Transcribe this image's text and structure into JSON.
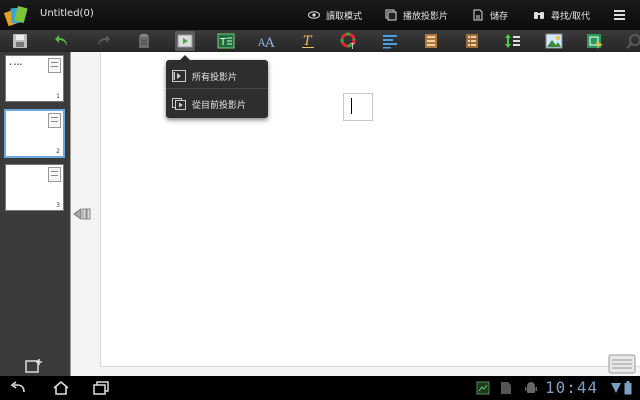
{
  "app": {
    "doc_title": "Untitled(0)"
  },
  "actionbar": {
    "read_mode_label": "讀取模式",
    "play_slides_label": "播放投影片",
    "save_label": "儲存",
    "find_replace_label": "尋找/取代"
  },
  "toolbar": {
    "icons": [
      "save-icon",
      "undo-icon",
      "redo-icon",
      "clipboard-icon",
      "play-slideshow-icon",
      "textbox-icon",
      "font-size-icon",
      "font-style-icon",
      "color-icon",
      "align-icon",
      "list-icon",
      "list-format-icon",
      "line-spacing-icon",
      "insert-image-icon",
      "shape-icon",
      "search-icon"
    ]
  },
  "slides": [
    {
      "number": "1",
      "preview_text": "• •••"
    },
    {
      "number": "2",
      "preview_text": ""
    },
    {
      "number": "3",
      "preview_text": ""
    }
  ],
  "popup_menu": {
    "items": [
      {
        "label": "所有投影片"
      },
      {
        "label": "從目前投影片"
      }
    ]
  },
  "statusbar": {
    "clock": "10:44"
  },
  "colors": {
    "accent_blue": "#6aa6e0",
    "clock_blue": "#7a9fc2",
    "popup_bg": "#2e2e2e"
  }
}
